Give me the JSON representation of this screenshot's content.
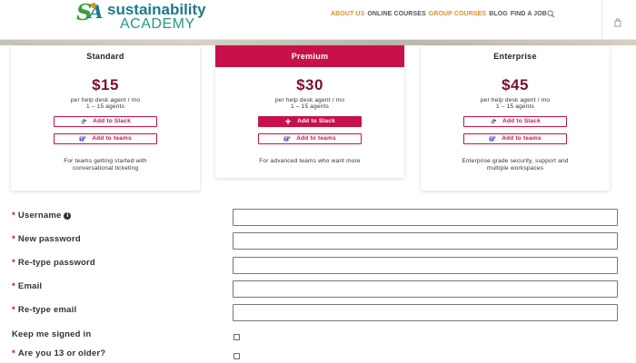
{
  "header": {
    "logo_line1": "sustainability",
    "logo_line2": "ACADEMY",
    "nav": [
      {
        "label": "ABOUT US",
        "highlight": true
      },
      {
        "label": "ONLINE COURSES",
        "highlight": false
      },
      {
        "label": "GROUP COURSES",
        "highlight": true
      },
      {
        "label": "BLOG",
        "highlight": false
      },
      {
        "label": "FIND A JOB",
        "highlight": false
      }
    ],
    "icons": [
      "search-icon",
      "cart-icon"
    ]
  },
  "plans": [
    {
      "name": "Standard",
      "price": "$15",
      "per_line1": "per help desk agent / mo",
      "per_line2": "1 – 15 agents",
      "slack_label": "Add to Slack",
      "teams_label": "Add to teams",
      "desc_line1": "For teams getting started with",
      "desc_line2": "conversational ticketing"
    },
    {
      "name": "Premium",
      "price": "$30",
      "per_line1": "per help desk agent / mo",
      "per_line2": "1 – 15 agents",
      "slack_label": "Add to Slack",
      "teams_label": "Add to teams",
      "desc_line1": "For advanced teams who want more",
      "desc_line2": ""
    },
    {
      "name": "Enterprise",
      "price": "$45",
      "per_line1": "per help desk agent / mo",
      "per_line2": "1 – 15 agents",
      "slack_label": "Add to Slack",
      "teams_label": "Add to teams",
      "desc_line1": "Enterprise grade security, support and",
      "desc_line2": "multiple workspaces"
    }
  ],
  "form": {
    "required_mark": "*",
    "username_label": "Username",
    "new_password_label": "New password",
    "retype_password_label": "Re-type password",
    "email_label": "Email",
    "retype_email_label": "Re-type email",
    "keep_signed_in_label": "Keep me signed in",
    "age_label": "Are you 13 or older?",
    "info_glyph": "i"
  },
  "colors": {
    "accent": "#c8114a",
    "price": "#7a1030",
    "nav_highlight": "#e88a1e",
    "logo_teal": "#1e7a8a",
    "logo_green": "#3aa13a"
  }
}
